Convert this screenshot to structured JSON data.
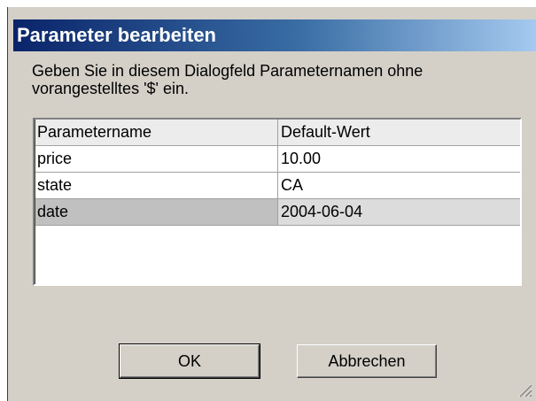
{
  "dialog": {
    "title": "Parameter bearbeiten",
    "instruction": "Geben Sie in diesem Dialogfeld Parameternamen ohne vorangestelltes '$' ein."
  },
  "table": {
    "columns": [
      "Parametername",
      "Default-Wert"
    ],
    "rows": [
      {
        "name": "price",
        "value": "10.00"
      },
      {
        "name": "state",
        "value": "CA"
      },
      {
        "name": "date",
        "value": "2004-06-04"
      }
    ],
    "selected_row": "date"
  },
  "buttons": {
    "ok_label": "OK",
    "cancel_label": "Abbrechen"
  },
  "colors": {
    "title_bar_start": "#0a246a",
    "title_bar_end": "#a6caf0",
    "dialog_background": "#d4d0c8",
    "selected_row": "#c0c0c0"
  }
}
